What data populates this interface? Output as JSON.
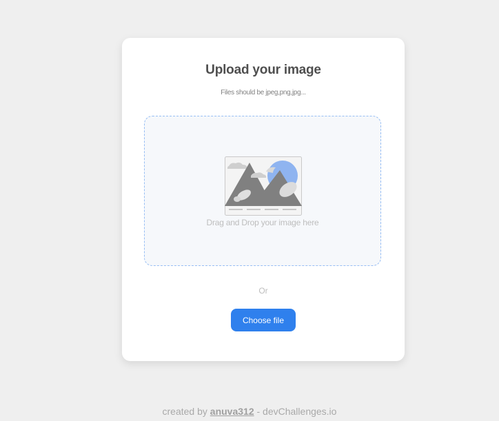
{
  "card": {
    "title": "Upload your image",
    "subtitle": "Files should be jpeg,png,jpg..."
  },
  "dropzone": {
    "illustration_icon": "mountain-image-icon",
    "text": "Drag and Drop your image here"
  },
  "divider_text": "Or",
  "choose_button": {
    "label": "Choose file"
  },
  "footer": {
    "prefix": "created by",
    "author": "anuva312",
    "suffix": "- devChallenges.io"
  },
  "colors": {
    "background": "#efefef",
    "card": "#ffffff",
    "accent": "#2f80ed",
    "dropzone_bg": "#f6f8fb",
    "dropzone_border": "#97bef4"
  }
}
